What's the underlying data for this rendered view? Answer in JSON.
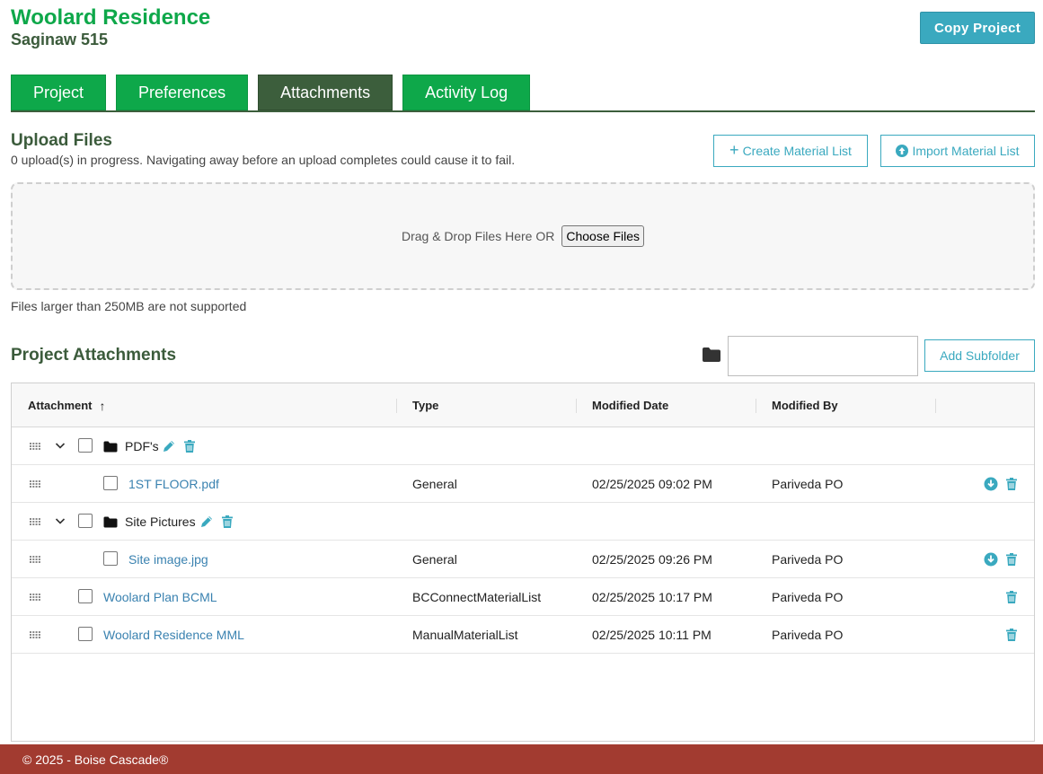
{
  "header": {
    "title": "Woolard Residence",
    "subtitle": "Saginaw 515",
    "copy_button": "Copy Project"
  },
  "tabs": [
    {
      "label": "Project",
      "active": false
    },
    {
      "label": "Preferences",
      "active": false
    },
    {
      "label": "Attachments",
      "active": true
    },
    {
      "label": "Activity Log",
      "active": false
    }
  ],
  "upload": {
    "title": "Upload Files",
    "status": "0 upload(s) in progress. Navigating away before an upload completes could cause it to fail.",
    "create_button": "Create Material List",
    "import_button": "Import Material List",
    "drop_text": "Drag & Drop Files Here OR",
    "choose_button": "Choose Files",
    "size_note": "Files larger than 250MB are not supported"
  },
  "attachments": {
    "title": "Project Attachments",
    "folder_input_value": "",
    "add_subfolder_button": "Add Subfolder",
    "columns": {
      "attachment": "Attachment",
      "sort_indicator": "↑",
      "type": "Type",
      "modified_date": "Modified Date",
      "modified_by": "Modified By"
    },
    "rows": [
      {
        "kind": "folder",
        "name": "PDF's",
        "type": "",
        "date": "",
        "by": ""
      },
      {
        "kind": "file",
        "name": "1ST FLOOR.pdf",
        "type": "General",
        "date": "02/25/2025 09:02 PM",
        "by": "Pariveda PO"
      },
      {
        "kind": "folder",
        "name": "Site Pictures",
        "type": "",
        "date": "",
        "by": ""
      },
      {
        "kind": "file",
        "name": "Site image.jpg",
        "type": "General",
        "date": "02/25/2025 09:26 PM",
        "by": "Pariveda PO"
      },
      {
        "kind": "list",
        "name": "Woolard Plan BCML",
        "type": "BCConnectMaterialList",
        "date": "02/25/2025 10:17 PM",
        "by": "Pariveda PO"
      },
      {
        "kind": "list",
        "name": "Woolard Residence MML",
        "type": "ManualMaterialList",
        "date": "02/25/2025 10:11 PM",
        "by": "Pariveda PO"
      }
    ]
  },
  "footer": {
    "text": "© 2025 - Boise Cascade®"
  },
  "colors": {
    "brand_green": "#0ea84a",
    "dark_green": "#3c5e3c",
    "accent_teal": "#3aa9bf",
    "footer_red": "#a23b30"
  }
}
